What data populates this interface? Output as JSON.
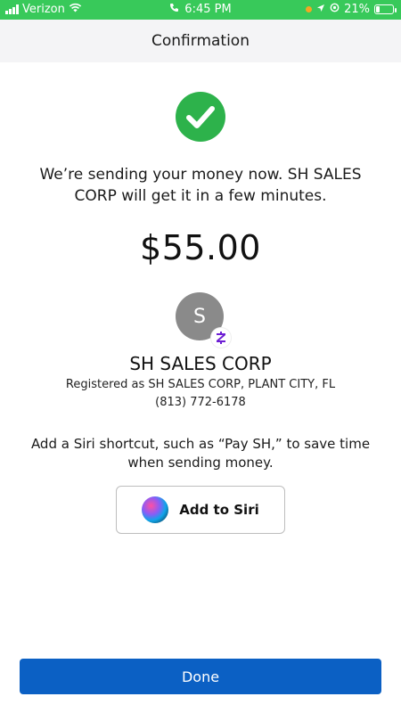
{
  "status_bar": {
    "carrier": "Verizon",
    "time": "6:45 PM",
    "battery_percent": "21%",
    "battery_level": 0.21,
    "icons": [
      "signal-icon",
      "wifi-icon",
      "phone-icon",
      "location-icon",
      "alarm-icon",
      "battery-icon"
    ]
  },
  "header": {
    "title": "Confirmation"
  },
  "confirmation": {
    "icon": "checkmark-icon",
    "message": "We’re sending your money now. SH SALES CORP will get it in a few minutes.",
    "amount": "$55.00"
  },
  "recipient": {
    "avatar_initial": "S",
    "badge_icon": "zelle-icon",
    "name": "SH SALES CORP",
    "registered_as": "Registered as SH SALES CORP, PLANT CITY, FL",
    "phone": "(813) 772-6178"
  },
  "siri": {
    "prompt": "Add a Siri shortcut, such as “Pay SH,” to save time when sending money.",
    "button_label": "Add to Siri",
    "icon": "siri-icon"
  },
  "footer": {
    "done_label": "Done"
  },
  "colors": {
    "status_bar": "#38c95a",
    "success_green": "#2db24b",
    "primary_button": "#0b60c4",
    "zelle_purple": "#6d1ed4"
  }
}
